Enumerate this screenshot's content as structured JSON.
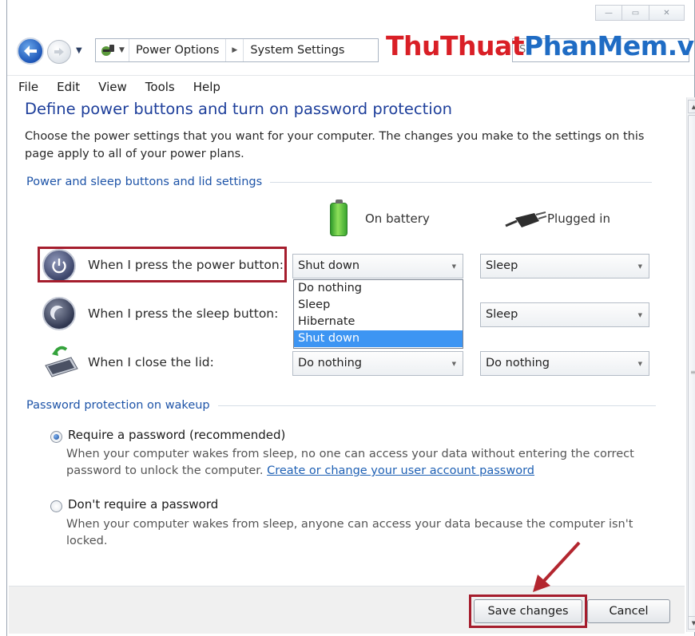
{
  "window_controls": {
    "minimize": "—",
    "maximize": "▭",
    "close": "✕"
  },
  "nav": {
    "breadcrumbs": [
      "Power Options",
      "System Settings"
    ],
    "search_placeholder": "S"
  },
  "watermark": {
    "part1": "ThuThuat",
    "part2": "PhanMem",
    "part3": ".vn"
  },
  "menu": [
    "File",
    "Edit",
    "View",
    "Tools",
    "Help"
  ],
  "page": {
    "title": "Define power buttons and turn on password protection",
    "description_lines": [
      "Choose the power settings that you want for your computer. The changes you make to the settings on this",
      "page apply to all of your power plans."
    ]
  },
  "buttons_section": {
    "heading": "Power and sleep buttons and lid settings",
    "col_battery": "On battery",
    "col_plugged": "Plugged in",
    "rows": [
      {
        "label": "When I press the power button:",
        "battery": "Shut down",
        "plugged": "Sleep"
      },
      {
        "label": "When I press the sleep button:",
        "battery": "Sleep",
        "plugged": "Sleep"
      },
      {
        "label": "When I close the lid:",
        "battery": "Do nothing",
        "plugged": "Do nothing"
      }
    ],
    "open_dropdown_options": [
      "Do nothing",
      "Sleep",
      "Hibernate",
      "Shut down"
    ],
    "open_dropdown_selected": "Shut down"
  },
  "password_section": {
    "heading": "Password protection on wakeup",
    "options": [
      {
        "label": "Require a password (recommended)",
        "selected": true,
        "desc_line1": "When your computer wakes from sleep, no one can access your data without entering the correct",
        "desc_line2_prefix": "password to unlock the computer.",
        "desc_link": "Create or change your user account password"
      },
      {
        "label": "Don't require a password",
        "selected": false,
        "desc_line1": "When your computer wakes from sleep, anyone can access your data because the computer isn't",
        "desc_line2": "locked."
      }
    ]
  },
  "footer": {
    "save": "Save changes",
    "cancel": "Cancel"
  },
  "colors": {
    "title_blue": "#1e3f9b",
    "section_blue": "#1e54a8",
    "highlight_red": "#a51d2d",
    "selection_blue": "#3d95f3"
  },
  "icons": [
    "back-arrow-icon",
    "forward-arrow-icon",
    "power-options-icon",
    "battery-icon",
    "plug-icon",
    "power-button-icon",
    "sleep-button-icon",
    "laptop-lid-icon"
  ]
}
